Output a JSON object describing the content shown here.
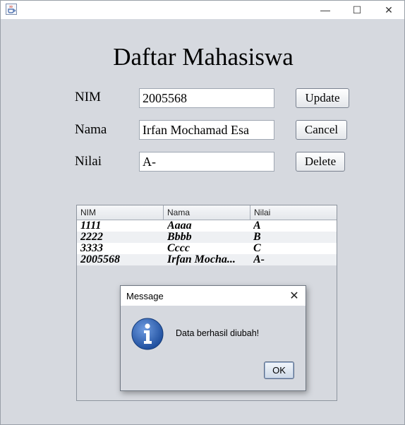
{
  "window": {
    "app_icon": "java-cup-icon",
    "controls": {
      "minimize": "—",
      "maximize": "☐",
      "close": "✕"
    }
  },
  "form": {
    "heading": "Daftar Mahasiswa",
    "nim_label": "NIM",
    "nim_value": "2005568",
    "nama_label": "Nama",
    "nama_value": "Irfan Mochamad Esa",
    "nilai_label": "Nilai",
    "nilai_value": "A-",
    "update_label": "Update",
    "cancel_label": "Cancel",
    "delete_label": "Delete"
  },
  "table": {
    "columns": [
      "NIM",
      "Nama",
      "Nilai"
    ],
    "rows": [
      [
        "1111",
        "Aaaa",
        "A"
      ],
      [
        "2222",
        "Bbbb",
        "B"
      ],
      [
        "3333",
        "Cccc",
        "C"
      ],
      [
        "2005568",
        "Irfan Mocha...",
        "A-"
      ]
    ]
  },
  "dialog": {
    "title": "Message",
    "close_glyph": "✕",
    "icon": "info-icon",
    "message": "Data berhasil diubah!",
    "ok_label": "OK"
  }
}
